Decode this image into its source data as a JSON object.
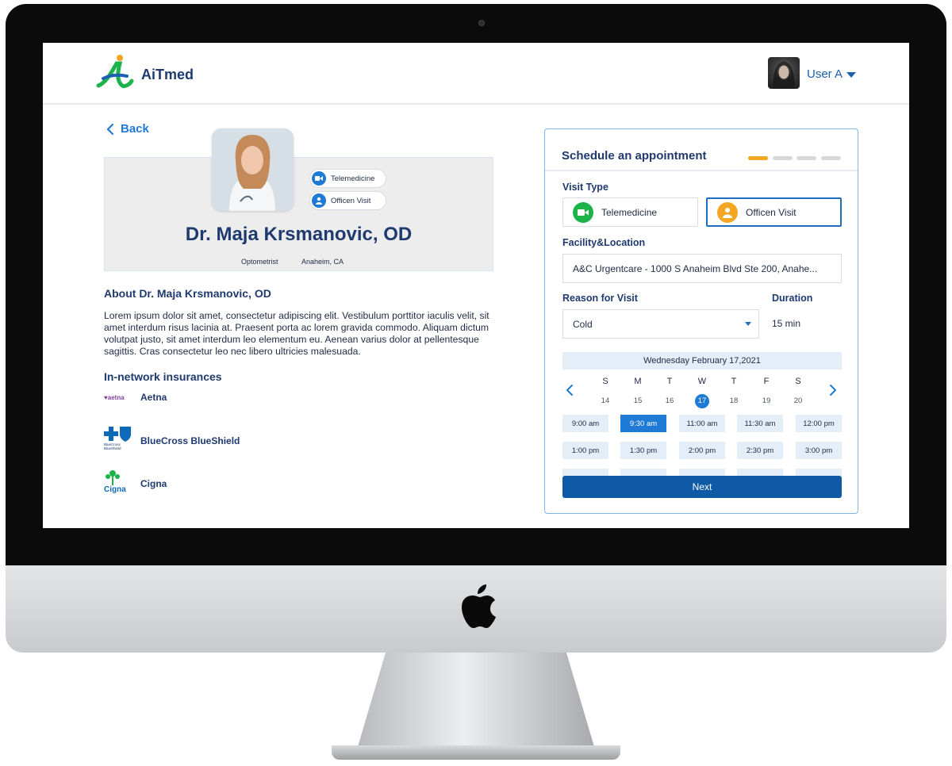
{
  "app": {
    "logo_text": "AiTmed"
  },
  "user": {
    "name": "User A"
  },
  "nav": {
    "back_label": "Back"
  },
  "doctor": {
    "name": "Dr. Maja Krsmanovic, OD",
    "specialty": "Optometrist",
    "location": "Anaheim, CA",
    "visit_badges": [
      "Telemedicine",
      "Officen Visit"
    ],
    "about_title": "About Dr. Maja Krsmanovic, OD",
    "about_text": "Lorem ipsum dolor sit amet, consectetur adipiscing elit. Vestibulum porttitor iaculis velit, sit amet interdum risus lacinia at. Praesent porta ac lorem gravida commodo. Aliquam dictum volutpat justo, sit amet interdum leo elementum eu. Aenean varius dolor at pellentesque sagittis. Cras consectetur leo nec libero ultricies malesuada."
  },
  "insurance": {
    "title": "In-network insurances",
    "items": [
      {
        "name": "Aetna",
        "logo_text": "aetna"
      },
      {
        "name": "BlueCross BlueShield",
        "logo_text": "BlueCross BlueShield"
      },
      {
        "name": "Cigna",
        "logo_text": "Cigna"
      }
    ]
  },
  "schedule": {
    "title": "Schedule an appointment",
    "step_current": 1,
    "step_total": 4,
    "visit_type_label": "Visit Type",
    "visit_types": [
      {
        "label": "Telemedicine",
        "selected": false
      },
      {
        "label": "Officen Visit",
        "selected": true
      }
    ],
    "facility_label": "Facility&Location",
    "facility_value": "A&C Urgentcare - 1000 S Anaheim Blvd Ste 200, Anahe...",
    "reason_label": "Reason for Visit",
    "reason_value": "Cold",
    "duration_label": "Duration",
    "duration_value": "15 min",
    "date_display": "Wednesday  February  17,2021",
    "days": [
      {
        "dow": "S",
        "num": "14"
      },
      {
        "dow": "M",
        "num": "15"
      },
      {
        "dow": "T",
        "num": "16"
      },
      {
        "dow": "W",
        "num": "17",
        "selected": true
      },
      {
        "dow": "T",
        "num": "18"
      },
      {
        "dow": "F",
        "num": "19"
      },
      {
        "dow": "S",
        "num": "20"
      }
    ],
    "time_slots": [
      {
        "label": "9:00 am"
      },
      {
        "label": "9:30 am",
        "selected": true
      },
      {
        "label": "11:00 am"
      },
      {
        "label": "11:30 am"
      },
      {
        "label": "12:00 pm"
      },
      {
        "label": "1:00 pm"
      },
      {
        "label": "1:30 pm"
      },
      {
        "label": "2:00 pm"
      },
      {
        "label": "2:30 pm"
      },
      {
        "label": "3:00 pm"
      }
    ],
    "next_label": "Next"
  },
  "colors": {
    "brand_blue": "#1e3a6e",
    "accent_blue": "#1f7ad6",
    "step_active": "#f5a623",
    "telemedicine_green": "#1bb34a",
    "office_orange": "#f5a623"
  },
  "icons": {
    "telemedicine": "video-camera-icon",
    "office_visit": "doctor-person-icon",
    "back": "chevron-left-icon",
    "user_menu": "caret-down-icon",
    "calendar_prev": "chevron-left-icon",
    "calendar_next": "chevron-right-icon"
  }
}
